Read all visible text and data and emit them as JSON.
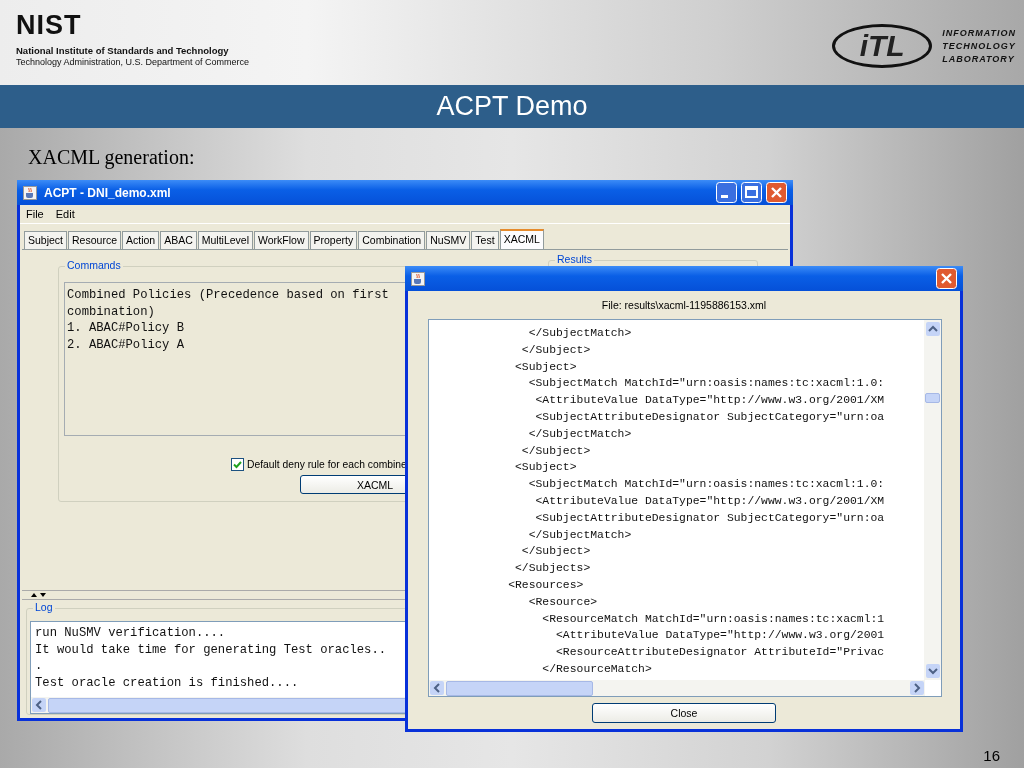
{
  "slide": {
    "logo": {
      "name": "NIST",
      "line1": "National Institute of Standards and Technology",
      "line2": "Technology Administration, U.S. Department of Commerce"
    },
    "lab_logo": {
      "mark": "iTL",
      "lines": [
        "INFORMATION",
        "TECHNOLOGY",
        "LABORATORY"
      ]
    },
    "title": "ACPT Demo",
    "caption": "XACML generation:",
    "page_number": "16"
  },
  "main_window": {
    "title": "ACPT - DNI_demo.xml",
    "menu": [
      "File",
      "Edit"
    ],
    "tabs": [
      {
        "label": "Subject",
        "selected": false
      },
      {
        "label": "Resource",
        "selected": false
      },
      {
        "label": "Action",
        "selected": false
      },
      {
        "label": "ABAC",
        "selected": false
      },
      {
        "label": "MultiLevel",
        "selected": false
      },
      {
        "label": "WorkFlow",
        "selected": false
      },
      {
        "label": "Property",
        "selected": false
      },
      {
        "label": "Combination",
        "selected": false
      },
      {
        "label": "NuSMV",
        "selected": false
      },
      {
        "label": "Test",
        "selected": false
      },
      {
        "label": "XACML",
        "selected": true
      }
    ],
    "commands": {
      "legend": "Commands",
      "lines": [
        "Combined Policies (Precedence based on first",
        "combination)",
        "1. ABAC#Policy B",
        "2. ABAC#Policy A"
      ]
    },
    "default_deny": {
      "label": "Default deny rule for each combine",
      "checked": true
    },
    "xacml_button": "XACML",
    "results_legend": "Results",
    "log": {
      "legend": "Log",
      "lines": [
        "run NuSMV verification....",
        "It would take time for generating Test oracles..",
        ".",
        "Test oracle creation is finished...."
      ]
    }
  },
  "dialog": {
    "file_label": "File: results\\xacml-1195886153.xml",
    "lines": [
      "              </SubjectMatch>",
      "             </Subject>",
      "            <Subject>",
      "              <SubjectMatch MatchId=\"urn:oasis:names:tc:xacml:1.0:",
      "               <AttributeValue DataType=\"http://www.w3.org/2001/XM",
      "               <SubjectAttributeDesignator SubjectCategory=\"urn:oa",
      "              </SubjectMatch>",
      "             </Subject>",
      "            <Subject>",
      "              <SubjectMatch MatchId=\"urn:oasis:names:tc:xacml:1.0:",
      "               <AttributeValue DataType=\"http://www.w3.org/2001/XM",
      "               <SubjectAttributeDesignator SubjectCategory=\"urn:oa",
      "              </SubjectMatch>",
      "             </Subject>",
      "            </Subjects>",
      "           <Resources>",
      "              <Resource>",
      "                <ResourceMatch MatchId=\"urn:oasis:names:tc:xacml:1",
      "                  <AttributeValue DataType=\"http://www.w3.org/2001",
      "                  <ResourceAttributeDesignator AttributeId=\"Privac",
      "                </ResourceMatch>"
    ],
    "close_button": "Close"
  }
}
